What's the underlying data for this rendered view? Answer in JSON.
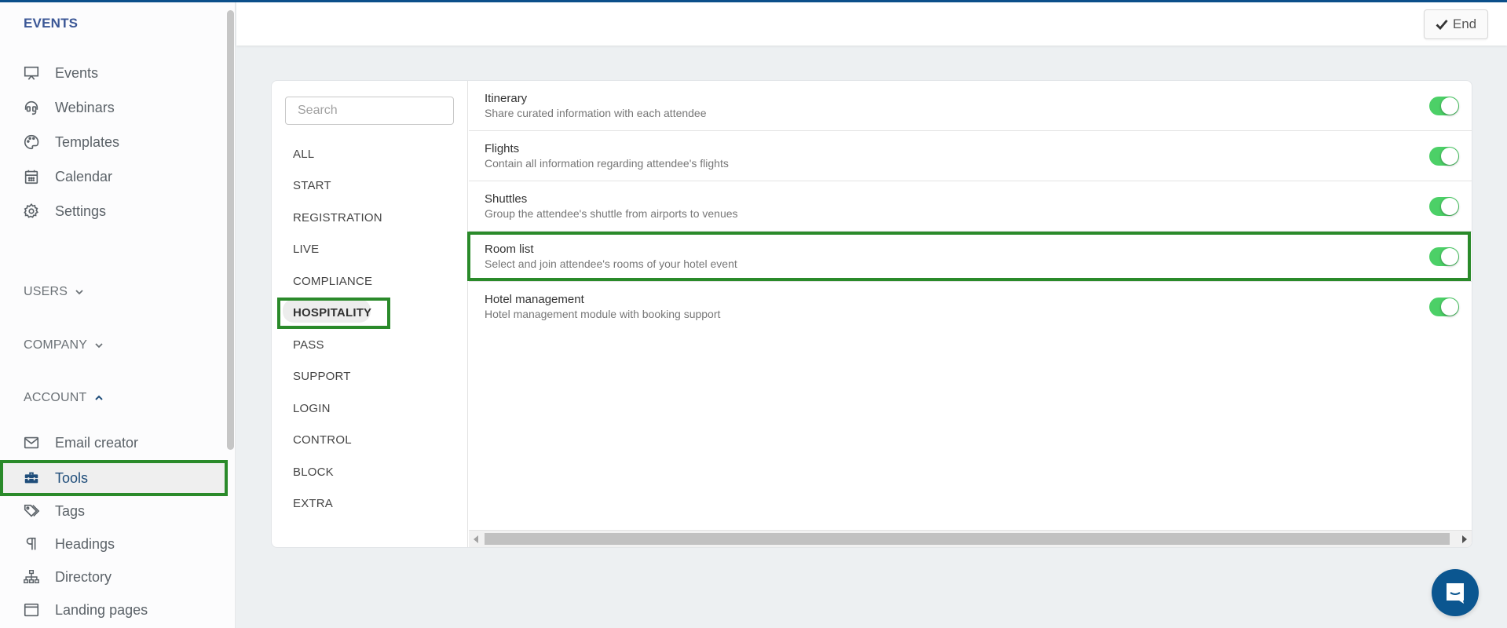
{
  "sidebar": {
    "title": "EVENTS",
    "main_items": [
      {
        "label": "Events",
        "icon": "presentation-icon"
      },
      {
        "label": "Webinars",
        "icon": "headset-icon"
      },
      {
        "label": "Templates",
        "icon": "palette-icon"
      },
      {
        "label": "Calendar",
        "icon": "calendar-icon"
      },
      {
        "label": "Settings",
        "icon": "gear-icon"
      }
    ],
    "sections": [
      {
        "label": "USERS",
        "expanded": false
      },
      {
        "label": "COMPANY",
        "expanded": false
      },
      {
        "label": "ACCOUNT",
        "expanded": true
      }
    ],
    "account_items": [
      {
        "label": "Email creator",
        "icon": "envelope-icon"
      },
      {
        "label": "Tools",
        "icon": "toolbox-icon",
        "active": true
      },
      {
        "label": "Tags",
        "icon": "tags-icon"
      },
      {
        "label": "Headings",
        "icon": "paragraph-icon"
      },
      {
        "label": "Directory",
        "icon": "sitemap-icon"
      },
      {
        "label": "Landing pages",
        "icon": "window-icon"
      }
    ]
  },
  "topbar": {
    "end_label": "End"
  },
  "categories": {
    "search_placeholder": "Search",
    "items": [
      "ALL",
      "START",
      "REGISTRATION",
      "LIVE",
      "COMPLIANCE",
      "HOSPITALITY",
      "PASS",
      "SUPPORT",
      "LOGIN",
      "CONTROL",
      "BLOCK",
      "EXTRA"
    ],
    "active": "HOSPITALITY"
  },
  "modules": [
    {
      "name": "Itinerary",
      "description": "Share curated information with each attendee",
      "enabled": true
    },
    {
      "name": "Flights",
      "description": "Contain all information regarding attendee's flights",
      "enabled": true
    },
    {
      "name": "Shuttles",
      "description": "Group the attendee's shuttle from airports to venues",
      "enabled": true
    },
    {
      "name": "Room list",
      "description": "Select and join attendee's rooms of your hotel event",
      "enabled": true,
      "highlighted": true
    },
    {
      "name": "Hotel management",
      "description": "Hotel management module with booking support",
      "enabled": true
    }
  ],
  "colors": {
    "brand": "#0b4f8a",
    "toggle_on": "#4cd067",
    "highlight": "#2a8a2a"
  }
}
